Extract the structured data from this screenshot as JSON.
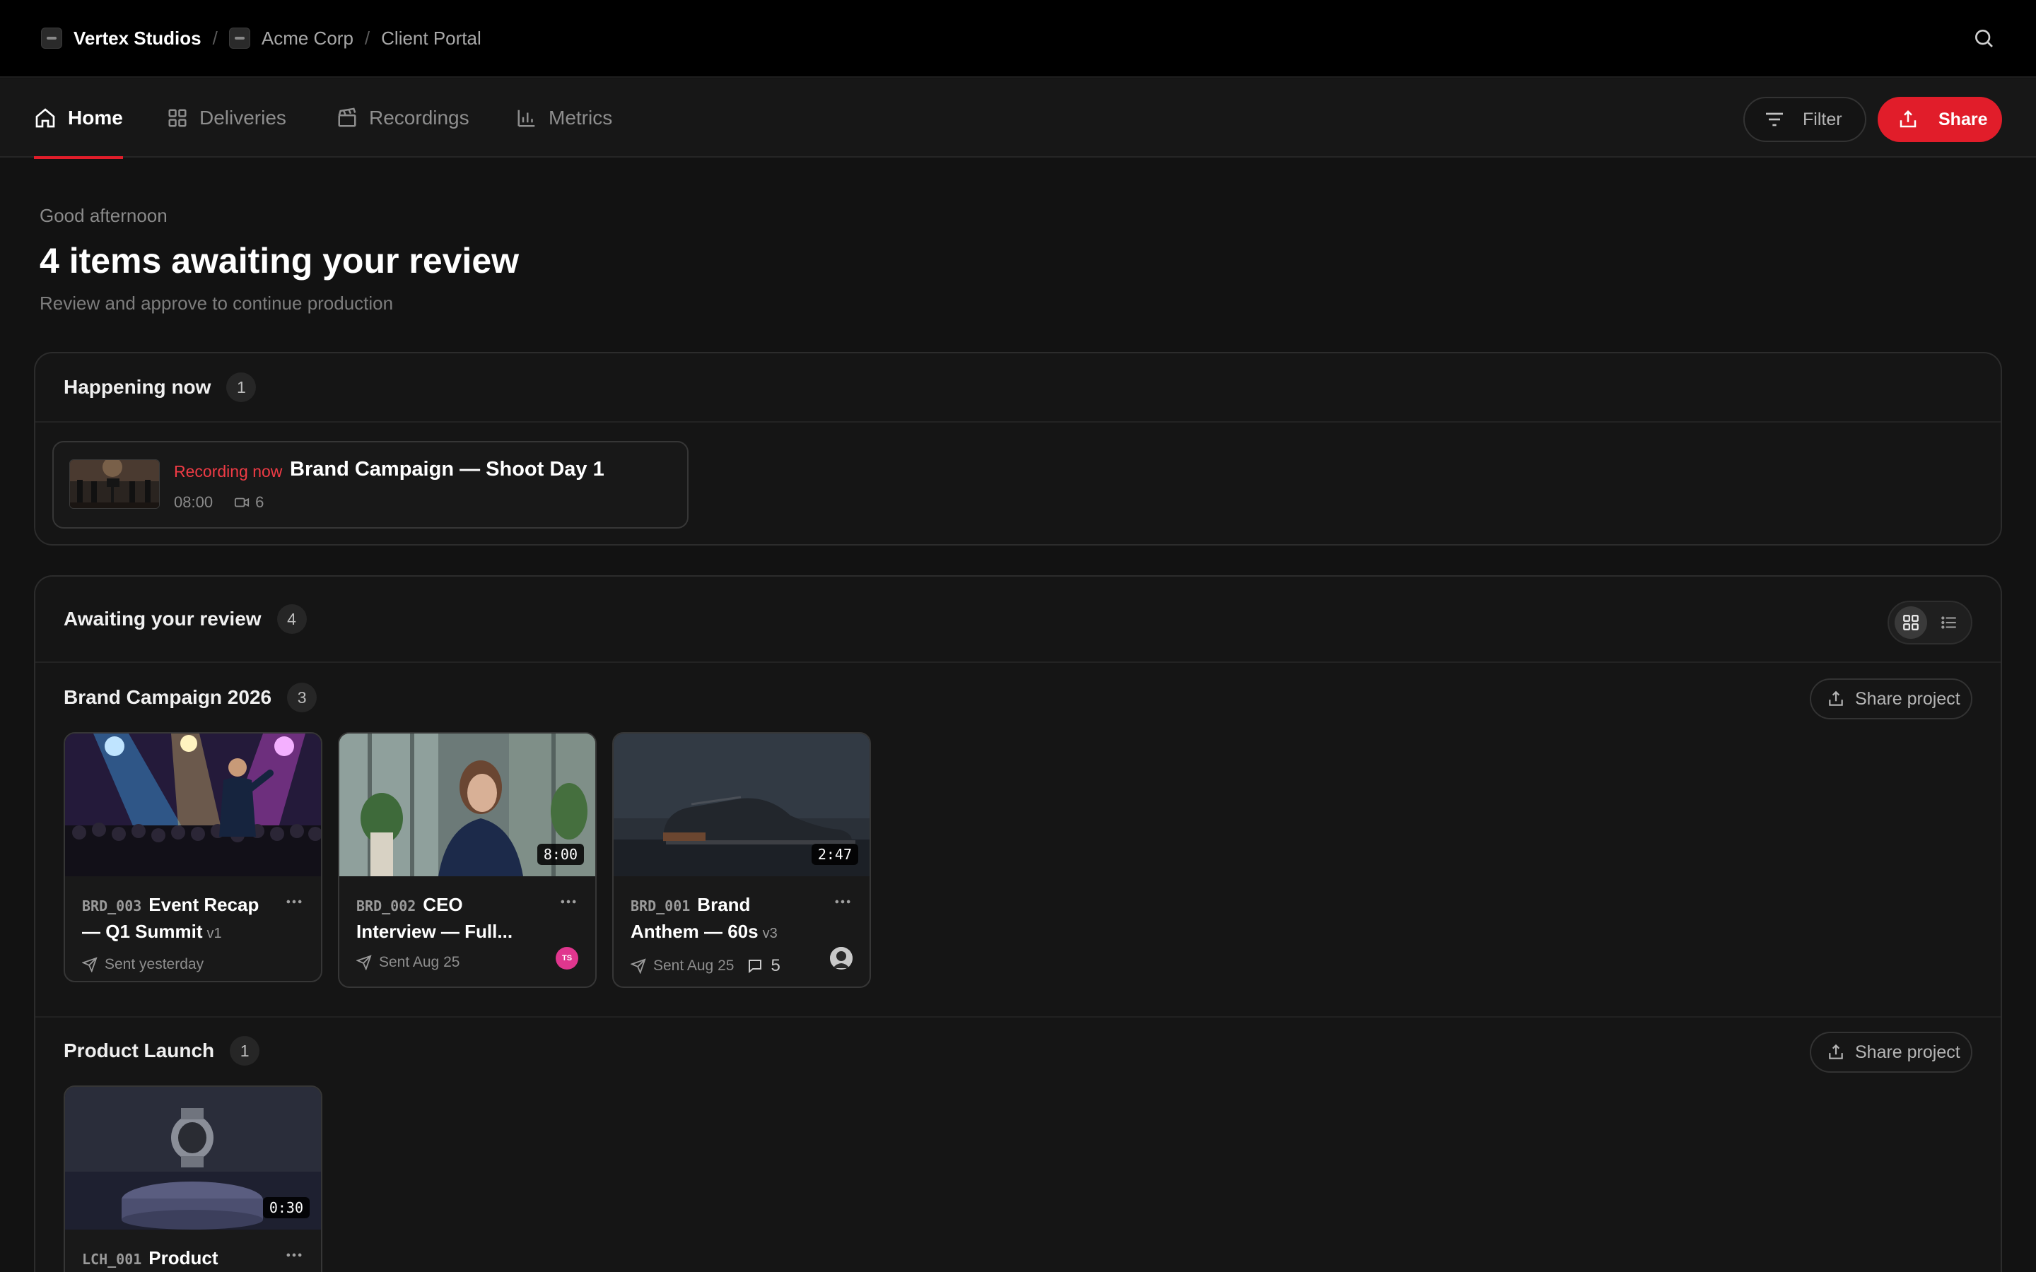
{
  "topbar": {
    "org": "Vertex Studios",
    "client": "Acme Corp",
    "portal": "Client Portal",
    "separator": "/"
  },
  "nav": {
    "tabs": [
      {
        "label": "Home",
        "icon": "home-icon",
        "active": true
      },
      {
        "label": "Deliveries",
        "icon": "grid-icon",
        "active": false
      },
      {
        "label": "Recordings",
        "icon": "clapperboard-icon",
        "active": false
      },
      {
        "label": "Metrics",
        "icon": "bar-chart-icon",
        "active": false
      }
    ],
    "filter_label": "Filter",
    "share_label": "Share"
  },
  "header": {
    "greeting": "Good afternoon",
    "title": "4 items awaiting your review",
    "subtitle": "Review and approve to continue production"
  },
  "happening_now": {
    "title": "Happening now",
    "count": "1",
    "item": {
      "tag": "Recording now",
      "title": "Brand Campaign — Shoot Day 1",
      "time": "08:00",
      "cameras": "6"
    }
  },
  "review": {
    "title": "Awaiting your review",
    "count": "4",
    "share_project_label": "Share project",
    "groups": [
      {
        "title": "Brand Campaign 2026",
        "count": "3",
        "cards": [
          {
            "code": "BRD_003",
            "title": "Event Recap — Q1 Summit",
            "version": "v1",
            "sent": "Sent yesterday",
            "duration": "",
            "comments": "",
            "avatar": ""
          },
          {
            "code": "BRD_002",
            "title": "CEO Interview — Full...",
            "version": "",
            "sent": "Sent Aug 25",
            "duration": "8:00",
            "comments": "",
            "avatar": "TS"
          },
          {
            "code": "BRD_001",
            "title": "Brand Anthem — 60s",
            "version": "v3",
            "sent": "Sent Aug 25",
            "duration": "2:47",
            "comments": "5",
            "avatar": ""
          }
        ]
      },
      {
        "title": "Product Launch",
        "count": "1",
        "cards": [
          {
            "code": "LCH_001",
            "title": "Product",
            "version": "",
            "sent": "",
            "duration": "0:30",
            "comments": "",
            "avatar": ""
          }
        ]
      }
    ]
  },
  "colors": {
    "accent": "#e11d2a",
    "background": "#121212",
    "live": "#ef3b45",
    "avatar_ts": "#e0368e"
  }
}
